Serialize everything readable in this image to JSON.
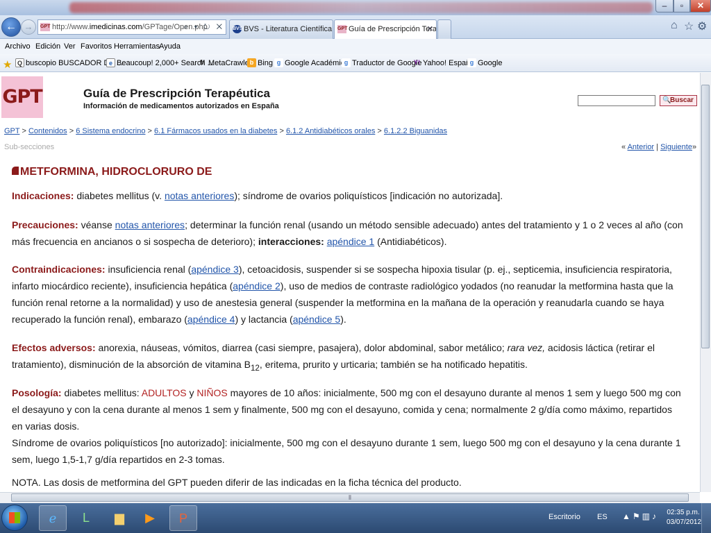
{
  "browser": {
    "address": {
      "prefix": "http://www.",
      "host": "imedicinas.com",
      "path": "/GPTage/Open.php",
      "controls": "⌕ ▾ ↻ ✕"
    },
    "tabs": [
      {
        "favicon": "BVS",
        "label": "BVS - Literatura Científica y Té..."
      },
      {
        "favicon": "GPT",
        "label": "Guía de Prescripción Terapé..."
      }
    ],
    "menu": [
      "Archivo",
      "Edición",
      "Ver",
      "Favoritos",
      "Herramientas",
      "Ayuda"
    ],
    "favorites": [
      {
        "label": "buscopio BUSCADOR DE ...",
        "icon": "Q"
      },
      {
        "label": "Beaucoup! 2,000+ Search ...",
        "icon": "e"
      },
      {
        "label": "MetaCrawler",
        "icon": "M"
      },
      {
        "label": "Bing",
        "icon": "b"
      },
      {
        "label": "Google Académico",
        "icon": "g"
      },
      {
        "label": "Traductor de Google",
        "icon": "g"
      },
      {
        "label": "Yahoo! España",
        "icon": "Y!"
      },
      {
        "label": "Google",
        "icon": "g"
      }
    ]
  },
  "page": {
    "logo": "GPT",
    "title": "Guía de Prescripción Terapéutica",
    "subtitle": "Información de medicamentos autorizados en España",
    "search_button": "Buscar",
    "breadcrumb": {
      "home": "GPT",
      "items": [
        "Contenidos",
        "6 Sistema endocrino",
        "6.1 Fármacos usados en la diabetes",
        "6.1.2 Antidiabéticos orales",
        "6.1.2.2 Biguanidas"
      ],
      "separator": ">"
    },
    "subsections": "Sub-secciones",
    "prev_prefix": "«",
    "prev": "Anterior",
    "next_sep": "|",
    "next": "Siguiente",
    "next_suffix": "»",
    "drug_title": "METFORMINA, HIDROCLORURO DE",
    "indicaciones": {
      "label": "Indicaciones:",
      "t1": " diabetes mellitus (v. ",
      "link1": "notas anteriores",
      "t2": "); síndrome de ovarios poliquísticos [indicación no autorizada]."
    },
    "precauciones": {
      "label": "Precauciones:",
      "t1": " véanse ",
      "link1": "notas anteriores",
      "t2": "; determinar la función renal (usando un método sensible adecuado) antes del tratamiento y 1 o 2 veces al año (con más frecuencia en ancianos o si sospecha de deterioro); ",
      "bold": "interacciones:",
      "t3": " ",
      "link2": "apéndice 1",
      "t4": " (Antidiabéticos)."
    },
    "contraindicaciones": {
      "label": "Contraindicaciones:",
      "t1": " insuficiencia renal (",
      "link1": "apéndice 3",
      "t2": "), cetoacidosis, suspender si se sospecha hipoxia tisular (p. ej., septicemia, insuficiencia respiratoria, infarto miocárdico reciente), insuficiencia hepática (",
      "link2": "apéndice 2",
      "t3": "), uso de medios de contraste radiológico yodados (no reanudar la metformina hasta que la función renal retorne a la normalidad) y uso de anestesia general (suspender la metformina en la mañana de la operación y reanudarla cuando se haya recuperado la función renal), embarazo (",
      "link3": "apéndice 4",
      "t4": ") y lactancia (",
      "link4": "apéndice 5",
      "t5": ")."
    },
    "efectos": {
      "label": "Efectos adversos:",
      "t1": " anorexia, náuseas, vómitos, diarrea (casi siempre, pasajera), dolor abdominal, sabor metálico; ",
      "italic": "rara vez,",
      "t2": " acidosis láctica (retirar el tratamiento), disminución de la absorción de vitamina B",
      "sub": "12",
      "t3": ", eritema, prurito y urticaria; también se ha notificado hepatitis."
    },
    "posologia": {
      "label": "Posología:",
      "t1": " diabetes mellitus: ",
      "adultos": "ADULTOS",
      "t2": " y ",
      "ninos": "NIÑOS",
      "t3": " mayores de 10 años: inicialmente, 500 mg con el desayuno durante al menos 1 sem y luego 500 mg con el desayuno y con la cena durante al menos 1 sem y finalmente, 500 mg con el desayuno, comida y cena; normalmente 2 g/día como máximo, repartidos en varias dosis.",
      "line2": "Síndrome de ovarios poliquísticos [no autorizado]: inicialmente, 500 mg con el desayuno durante 1 sem, luego 500 mg con el desayuno y la cena durante 1 sem, luego 1,5-1,7 g/día repartidos en 2-3 tomas."
    },
    "nota": "NOTA. Las dosis de metformina del GPT pueden diferir de las indicadas en la ficha técnica del producto."
  },
  "taskbar": {
    "escritorio": "Escritorio",
    "lang": "ES",
    "time": "02:35 p.m.",
    "date": "03/07/2012"
  }
}
